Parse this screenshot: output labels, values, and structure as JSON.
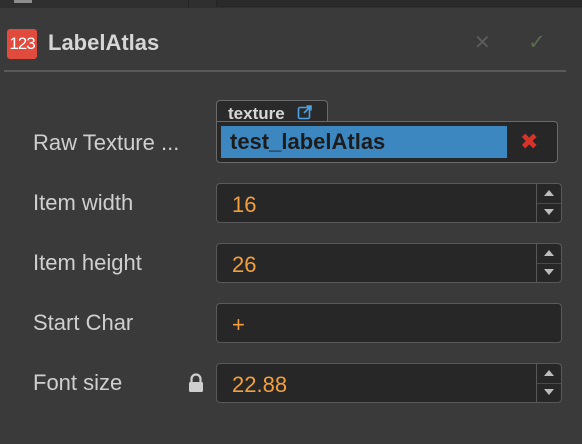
{
  "component": {
    "icon_text": "123",
    "title": "LabelAtlas",
    "icons": {
      "remove": "close-icon",
      "apply": "checkmark-icon"
    }
  },
  "properties": {
    "raw_texture": {
      "label": "Raw Texture ...",
      "tab_label": "texture",
      "value": "test_labelAtlas",
      "icons": {
        "tab": "external-link-icon",
        "remove": "close-icon"
      }
    },
    "item_width": {
      "label": "Item width",
      "value": "16"
    },
    "item_height": {
      "label": "Item height",
      "value": "26"
    },
    "start_char": {
      "label": "Start Char",
      "value": "+"
    },
    "font_size": {
      "label": "Font size",
      "value": "22.88",
      "locked": true,
      "lock_icon": "lock-icon"
    }
  },
  "colors": {
    "value_text": "#f0a040",
    "component_icon_bg": "#e04b3d",
    "texture_highlight": "#3d87c0",
    "remove_red": "#d7332b"
  }
}
